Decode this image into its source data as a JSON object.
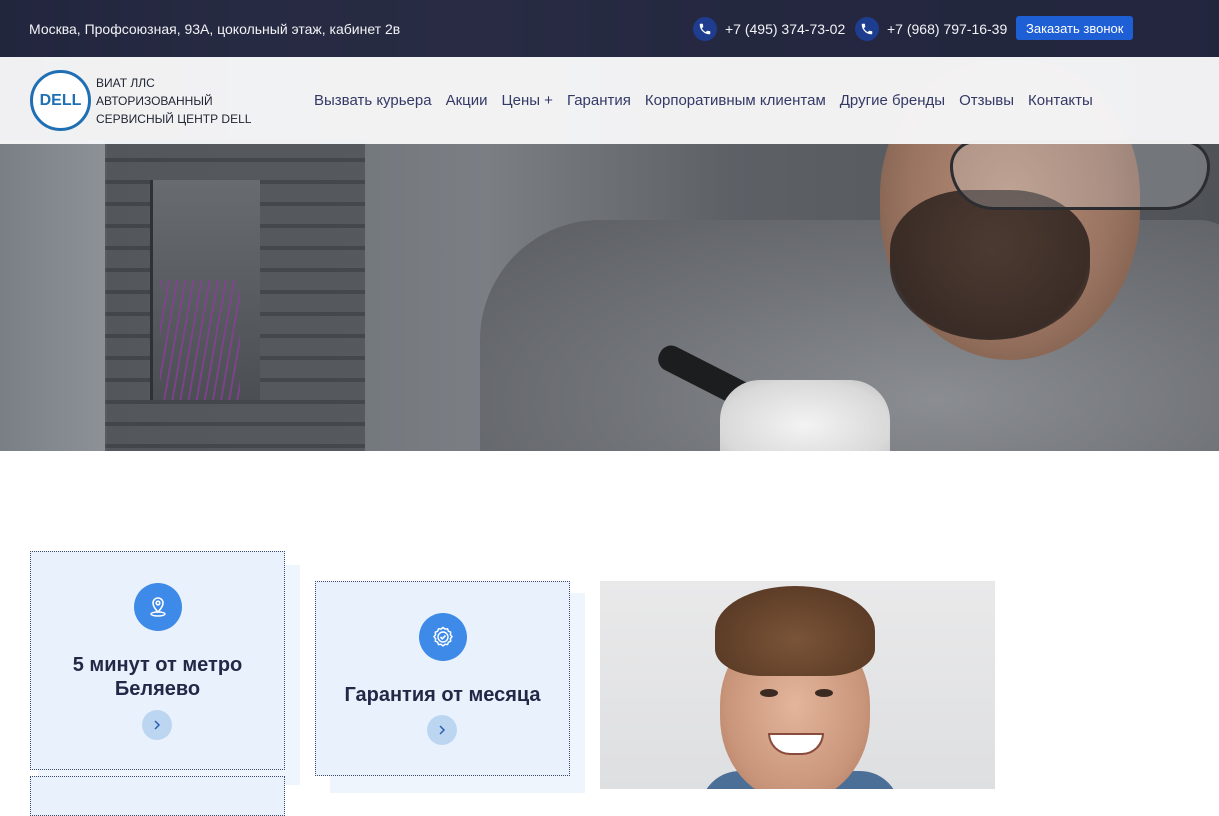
{
  "topbar": {
    "address": "Москва, Профсоюзная, 93А, цокольный этаж, кабинет 2в",
    "phones": [
      "+7 (495) 374-73-02",
      "+7 (968) 797-16-39"
    ],
    "callback_label": "Заказать звонок"
  },
  "brand": {
    "logo_text": "DELL",
    "line1": "ВИАТ ЛЛС",
    "line2": "АВТОРИЗОВАННЫЙ",
    "line3": "СЕРВИСНЫЙ ЦЕНТР DELL"
  },
  "nav": {
    "items": [
      "Вызвать курьера",
      "Акции",
      "Цены +",
      "Гарантия",
      "Корпоративным клиентам",
      "Другие бренды",
      "Отзывы",
      "Контакты"
    ]
  },
  "features": [
    {
      "title_line1": "5 минут от метро",
      "title_line2": "Беляево",
      "icon": "location-pin-icon"
    },
    {
      "title_line1": "Гарантия от месяца",
      "icon": "badge-check-icon"
    }
  ],
  "colors": {
    "accent": "#1e5fd6",
    "nav_text": "#343a66",
    "card_bg": "#e9f2fc",
    "icon_bg": "#3d8ae8"
  }
}
